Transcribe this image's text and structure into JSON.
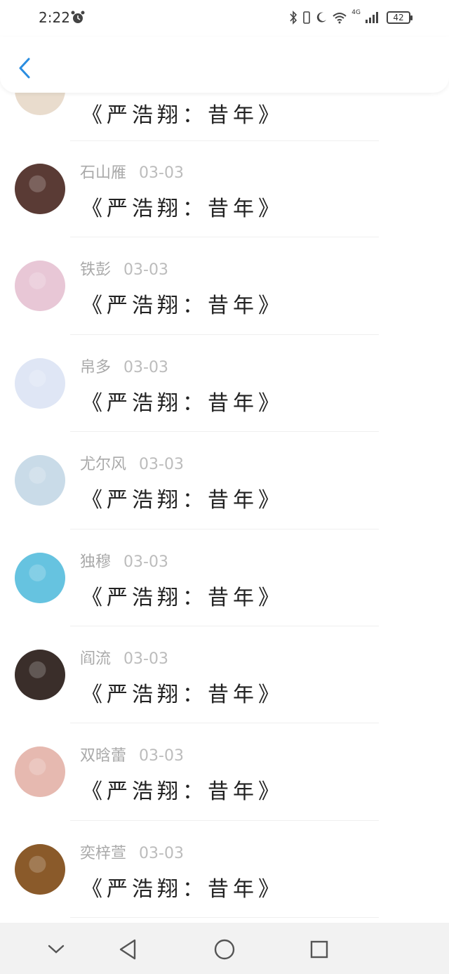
{
  "status": {
    "time": "2:22",
    "network": "4G",
    "battery": "42"
  },
  "header": {
    "back_icon": "chevron-left-icon"
  },
  "list": {
    "first_partial_poem": "《严浩翔：昔年》",
    "items": [
      {
        "name": "石山雁",
        "date": "03-03",
        "poem": "《严浩翔：昔年》",
        "avatar_color": "#5a3b35"
      },
      {
        "name": "铁彭",
        "date": "03-03",
        "poem": "《严浩翔：昔年》",
        "avatar_color": "#e8c7d6"
      },
      {
        "name": "帛多",
        "date": "03-03",
        "poem": "《严浩翔：昔年》",
        "avatar_color": "#dfe6f5"
      },
      {
        "name": "尤尔风",
        "date": "03-03",
        "poem": "《严浩翔：昔年》",
        "avatar_color": "#c9dbe8"
      },
      {
        "name": "独穆",
        "date": "03-03",
        "poem": "《严浩翔：昔年》",
        "avatar_color": "#66c3e0"
      },
      {
        "name": "阎流",
        "date": "03-03",
        "poem": "《严浩翔：昔年》",
        "avatar_color": "#3a2e2a"
      },
      {
        "name": "双晗蕾",
        "date": "03-03",
        "poem": "《严浩翔：昔年》",
        "avatar_color": "#e6b9b0"
      },
      {
        "name": "奕梓萱",
        "date": "03-03",
        "poem": "《严浩翔：昔年》",
        "avatar_color": "#8a5a2a"
      }
    ]
  },
  "nav": {
    "icons": [
      "chevron-down-icon",
      "back-triangle-icon",
      "home-circle-icon",
      "recents-square-icon"
    ]
  }
}
